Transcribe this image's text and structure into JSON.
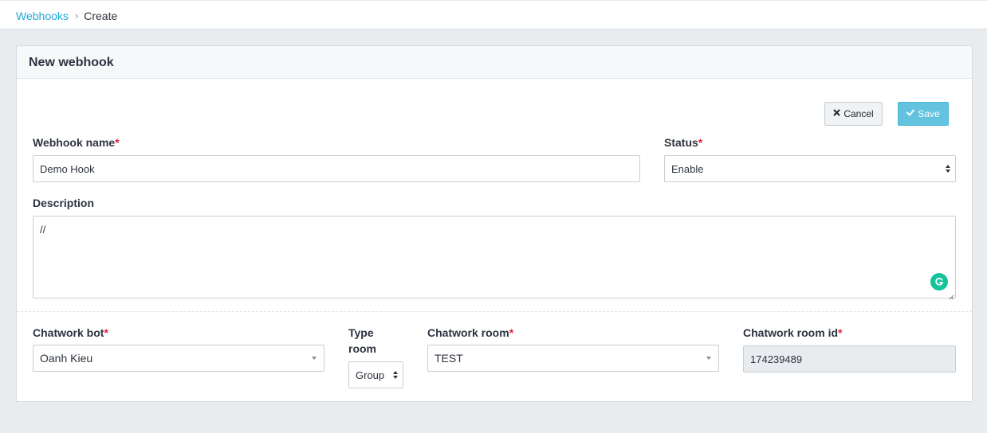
{
  "breadcrumb": {
    "parent": "Webhooks",
    "separator": "›",
    "current": "Create"
  },
  "card": {
    "title": "New webhook"
  },
  "actions": {
    "cancel_label": "Cancel",
    "save_label": "Save"
  },
  "form": {
    "webhook_name": {
      "label": "Webhook name",
      "required_mark": "*",
      "value": "Demo Hook"
    },
    "status": {
      "label": "Status",
      "required_mark": "*",
      "value": "Enable"
    },
    "description": {
      "label": "Description",
      "value": "//"
    },
    "chatwork_bot": {
      "label": "Chatwork bot",
      "required_mark": "*",
      "value": "Oanh Kieu"
    },
    "type_room": {
      "label_line1": "Type",
      "label_line2": "room",
      "value": "Group"
    },
    "chatwork_room": {
      "label": "Chatwork room",
      "required_mark": "*",
      "value": "TEST"
    },
    "chatwork_room_id": {
      "label": "Chatwork room id",
      "required_mark": "*",
      "value": "174239489"
    }
  },
  "colors": {
    "link": "#20a8d8",
    "save_button": "#63c2de",
    "required": "#e0203a",
    "grammarly": "#15c39a",
    "page_background": "#e9ecef"
  },
  "icons": {
    "cancel": "times-icon",
    "save": "check-icon",
    "grammarly": "grammarly-icon"
  }
}
